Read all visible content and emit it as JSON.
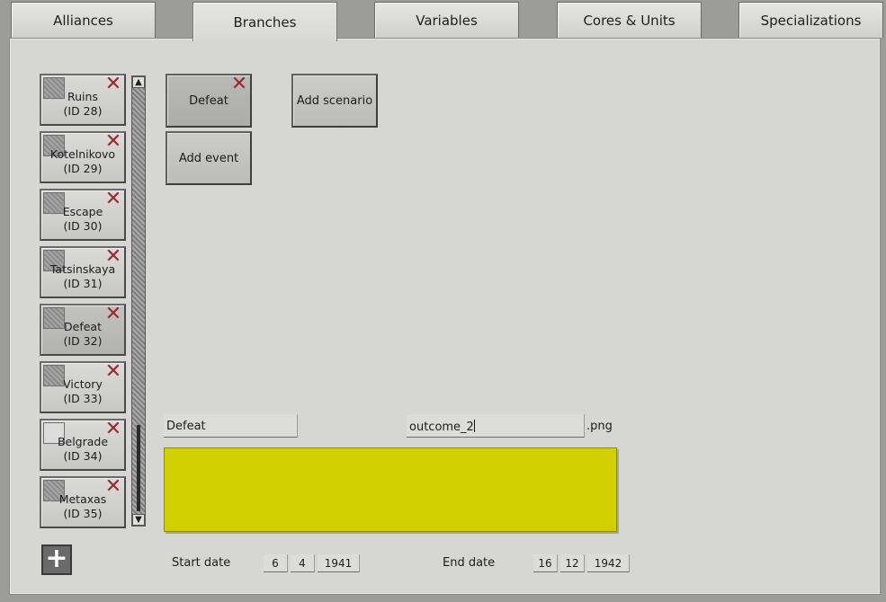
{
  "tabs": [
    {
      "label": "Alliances"
    },
    {
      "label": "Branches"
    },
    {
      "label": "Variables"
    },
    {
      "label": "Cores & Units"
    },
    {
      "label": "Specializations"
    }
  ],
  "active_tab": "Branches",
  "branches": [
    {
      "name": "Ruins",
      "id": "(ID 28)"
    },
    {
      "name": "Kotelnikovo",
      "id": "(ID 29)"
    },
    {
      "name": "Escape",
      "id": "(ID 30)"
    },
    {
      "name": "Tatsinskaya",
      "id": "(ID 31)"
    },
    {
      "name": "Defeat",
      "id": "(ID 32)"
    },
    {
      "name": "Victory",
      "id": "(ID 33)"
    },
    {
      "name": "Belgrade",
      "id": "(ID 34)"
    },
    {
      "name": "Metaxas",
      "id": "(ID 35)"
    }
  ],
  "selected_branch": "Defeat",
  "events": {
    "selected_event": "Defeat",
    "add_event_label": "Add event",
    "add_scenario_label": "Add scenario"
  },
  "details": {
    "name_value": "Defeat",
    "image_value": "outcome_2",
    "image_ext": ".png",
    "color": "#d2d000"
  },
  "dates": {
    "start_label": "Start date",
    "start": {
      "day": "6",
      "month": "4",
      "year": "1941"
    },
    "end_label": "End date",
    "end": {
      "day": "16",
      "month": "12",
      "year": "1942"
    }
  },
  "icons": {
    "remove": "close-x-icon",
    "add": "plus-icon",
    "scroll_up": "arrow-up-icon",
    "scroll_down": "arrow-down-icon"
  }
}
